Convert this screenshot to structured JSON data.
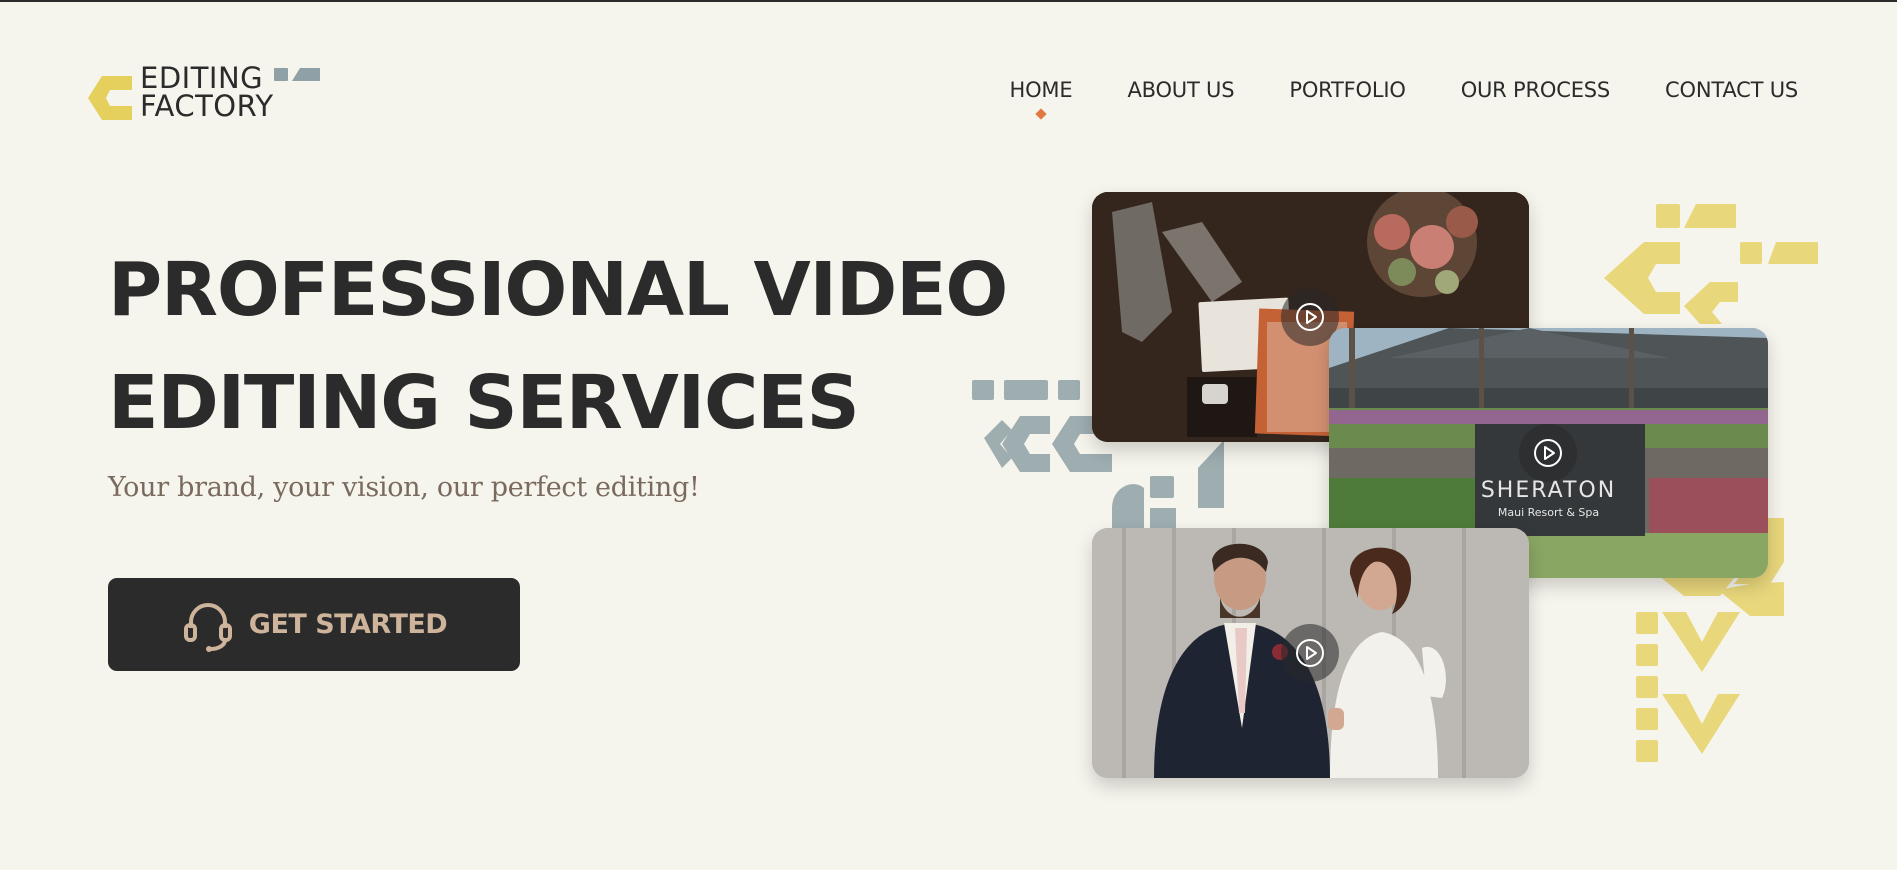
{
  "brand": {
    "name_line1": "EDITING",
    "name_line2": "FACTORY",
    "colors": {
      "yellow": "#e5cf5d",
      "slate": "#8fa1a6",
      "dark": "#2b2b2b"
    }
  },
  "nav": {
    "items": [
      {
        "label": "HOME",
        "active": true
      },
      {
        "label": "ABOUT US",
        "active": false
      },
      {
        "label": "PORTFOLIO",
        "active": false
      },
      {
        "label": "OUR PROCESS",
        "active": false
      },
      {
        "label": "CONTACT US",
        "active": false
      }
    ],
    "active_indicator_color": "#e0793f"
  },
  "hero": {
    "title_line1": "PROFESSIONAL VIDEO",
    "title_line2": "EDITING SERVICES",
    "subtitle": "Your brand, your vision, our perfect editing!",
    "cta": {
      "label": "GET STARTED",
      "icon": "headset-icon",
      "text_color": "#cdb49a"
    }
  },
  "videos": [
    {
      "scene": "wedding details flat-lay",
      "icon": "play-icon"
    },
    {
      "scene": "resort entrance",
      "sign_title": "SHERATON",
      "sign_subtitle": "Maui Resort & Spa",
      "icon": "play-icon"
    },
    {
      "scene": "bride and groom portrait",
      "icon": "play-icon"
    }
  ],
  "decor": {
    "accent_colors": [
      "#e9d77c",
      "#9eadb0"
    ]
  }
}
